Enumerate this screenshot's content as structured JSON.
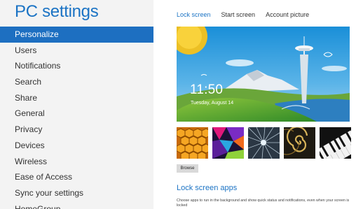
{
  "app_title": "PC settings",
  "nav": {
    "items": [
      {
        "label": "Personalize",
        "active": true
      },
      {
        "label": "Users"
      },
      {
        "label": "Notifications"
      },
      {
        "label": "Search"
      },
      {
        "label": "Share"
      },
      {
        "label": "General"
      },
      {
        "label": "Privacy"
      },
      {
        "label": "Devices"
      },
      {
        "label": "Wireless"
      },
      {
        "label": "Ease of Access"
      },
      {
        "label": "Sync your settings"
      },
      {
        "label": "HomeGroup"
      }
    ]
  },
  "tabs": [
    {
      "label": "Lock screen",
      "active": true
    },
    {
      "label": "Start screen"
    },
    {
      "label": "Account picture"
    }
  ],
  "lock_preview": {
    "time": "11:50",
    "date": "Tuesday, August 14"
  },
  "thumbnails": [
    {
      "name": "honeycomb-thumbnail"
    },
    {
      "name": "geometric-thumbnail"
    },
    {
      "name": "tunnel-thumbnail"
    },
    {
      "name": "nautilus-thumbnail"
    },
    {
      "name": "piano-thumbnail"
    }
  ],
  "browse_label": "Browse",
  "lock_screen_apps": {
    "title": "Lock screen apps",
    "description": "Choose apps to run in the background and show quick status and notifications, even when your screen is locked"
  },
  "colors": {
    "accent": "#1b73c4",
    "active_nav": "#1d6fc1",
    "left_pane": "#f3f3f3"
  }
}
